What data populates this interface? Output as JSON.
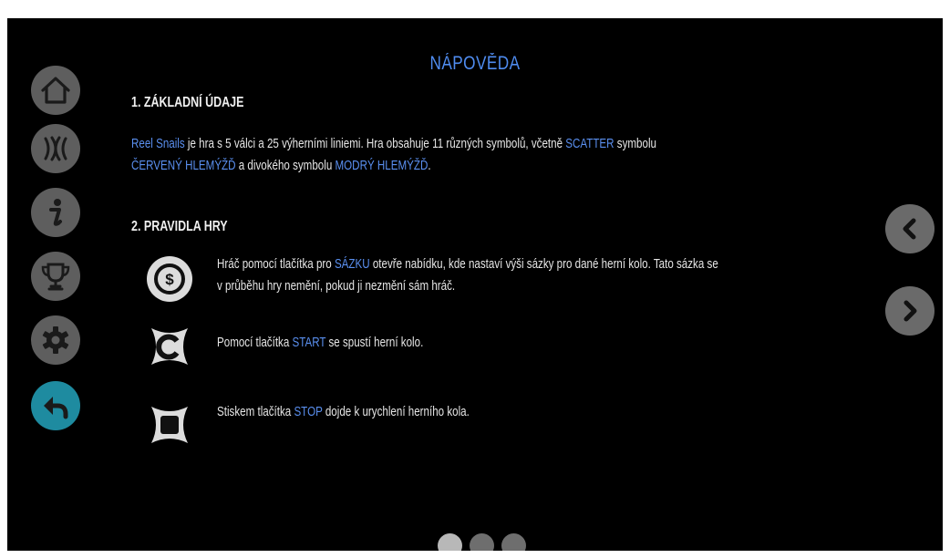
{
  "help": {
    "title": "NÁPOVĚDA",
    "section1": {
      "heading": "1. ZÁKLADNÍ ÚDAJE",
      "game_name": "Reel Snails",
      "text1": " je hra s 5 válci a 25 výherními liniemi. Hra obsahuje 11 různých symbolů, včetně ",
      "scatter": "SCATTER",
      "text2": " symbolu",
      "red_snail": "ČERVENÝ HLEMÝŽĎ",
      "text3": " a divokého symbolu ",
      "blue_snail": "MODRÝ HLEMÝŽĎ",
      "text4": "."
    },
    "section2": {
      "heading": "2. PRAVIDLA HRY",
      "bet": {
        "text1": "Hráč pomocí tlačítka pro ",
        "keyword": "SÁZKU",
        "text2": " otevře nabídku, kde nastaví výši sázky pro dané herní kolo. Tato sázka se",
        "line2": "v průběhu hry nemění, pokud ji nezmění sám hráč."
      },
      "start": {
        "text1": "Pomocí tlačítka ",
        "keyword": "START",
        "text2": " se spustí herní kolo."
      },
      "stop": {
        "text1": "Stiskem tlačítka ",
        "keyword": "STOP",
        "text2": " dojde k urychlení herního kola."
      }
    }
  },
  "sidebar": {
    "items": [
      {
        "icon": "home-icon"
      },
      {
        "icon": "paylines-icon"
      },
      {
        "icon": "info-icon"
      },
      {
        "icon": "trophy-icon"
      },
      {
        "icon": "settings-icon"
      },
      {
        "icon": "back-icon",
        "active": true
      }
    ]
  },
  "pagination": {
    "page_count": 3,
    "current_page": 1
  },
  "colors": {
    "accent": "#5a8fef",
    "active_button": "#1e8ba0",
    "inactive_button": "#5e5e5e",
    "background": "#000000"
  }
}
